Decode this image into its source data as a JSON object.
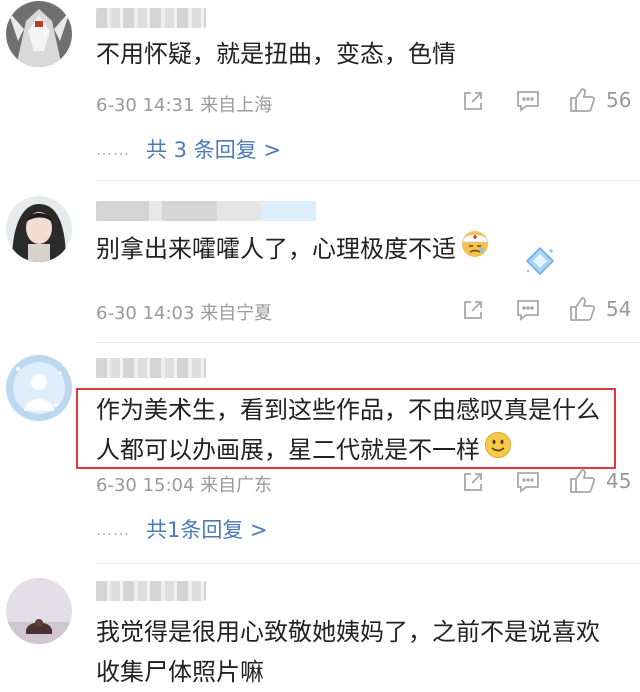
{
  "comments": [
    {
      "text": "不用怀疑，就是扭曲，变态，色情",
      "date": "6-30 14:31",
      "location": "来自上海",
      "likes": "56",
      "replies_label": "共 3 条回复 >"
    },
    {
      "text": "别拿出来嚯嚯人了，心理极度不适",
      "date": "6-30 14:03",
      "location": "来自宁夏",
      "likes": "54"
    },
    {
      "text_line1": "作为美术生，看到这些作品，不由感叹真是什么",
      "text_line2": "人都可以办画展，星二代就是不一样",
      "date": "6-30 15:04",
      "location": "来自广东",
      "likes": "45",
      "replies_label": "共1条回复 >"
    },
    {
      "text_line1": "我觉得是很用心致敬她姨妈了，之前不是说喜欢",
      "text_line2": "收集尸体照片嘛"
    }
  ],
  "replies_dots": "……",
  "icons": {
    "share": "share-icon",
    "comment": "comment-icon",
    "like": "thumbs-up-icon"
  },
  "colors": {
    "link": "#4a7ab8",
    "meta": "#999999",
    "highlight_border": "#e5383b"
  }
}
